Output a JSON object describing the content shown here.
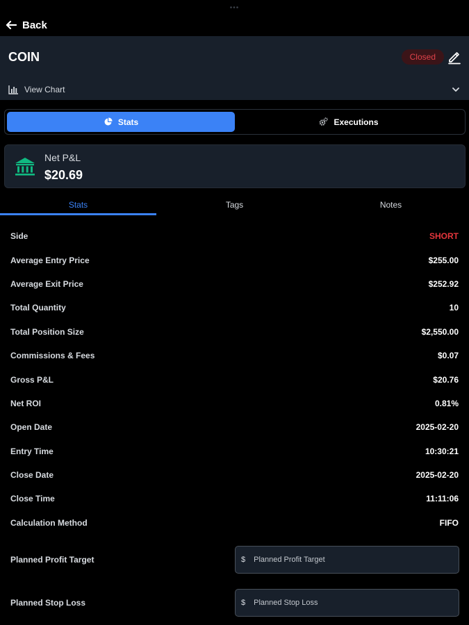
{
  "top": {
    "handle": "•••",
    "back_label": "Back"
  },
  "header": {
    "ticker": "COIN",
    "status": "Closed",
    "view_chart": "View Chart"
  },
  "segments": [
    {
      "label": "Stats"
    },
    {
      "label": "Executions"
    }
  ],
  "pnl": {
    "label": "Net P&L",
    "value": "$20.69"
  },
  "tabs": [
    {
      "label": "Stats"
    },
    {
      "label": "Tags"
    },
    {
      "label": "Notes"
    }
  ],
  "stats": [
    {
      "label": "Side",
      "value": "SHORT"
    },
    {
      "label": "Average Entry Price",
      "value": "$255.00"
    },
    {
      "label": "Average Exit Price",
      "value": "$252.92"
    },
    {
      "label": "Total Quantity",
      "value": "10"
    },
    {
      "label": "Total Position Size",
      "value": "$2,550.00"
    },
    {
      "label": "Commissions & Fees",
      "value": "$0.07"
    },
    {
      "label": "Gross P&L",
      "value": "$20.76"
    },
    {
      "label": "Net ROI",
      "value": "0.81%"
    },
    {
      "label": "Open Date",
      "value": "2025-02-20"
    },
    {
      "label": "Entry Time",
      "value": "10:30:21"
    },
    {
      "label": "Close Date",
      "value": "2025-02-20"
    },
    {
      "label": "Close Time",
      "value": "11:11:06"
    },
    {
      "label": "Calculation Method",
      "value": "FIFO"
    }
  ],
  "inputs": {
    "profit_target": {
      "label": "Planned Profit Target",
      "prefix": "$",
      "placeholder": "Planned Profit Target",
      "value": ""
    },
    "stop_loss": {
      "label": "Planned Stop Loss",
      "prefix": "$",
      "placeholder": "Planned Stop Loss",
      "value": ""
    }
  },
  "colors": {
    "accent": "#3b82f6",
    "short": "#e5363c",
    "closed_badge": "#e0424a",
    "bank_icon": "#10b981",
    "card_bg": "#18202b"
  }
}
